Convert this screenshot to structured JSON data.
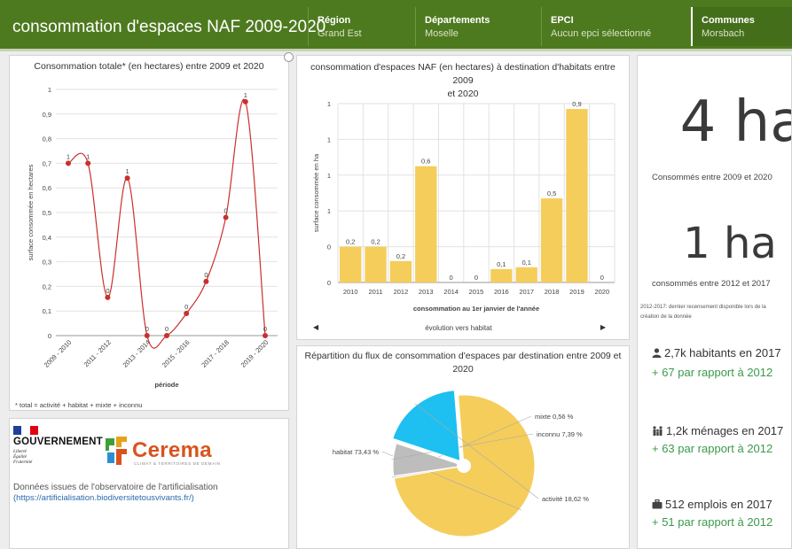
{
  "header": {
    "title": "consommation d'espaces NAF 2009-2020",
    "filters": [
      {
        "label": "Région",
        "value": "Grand Est"
      },
      {
        "label": "Départements",
        "value": "Moselle"
      },
      {
        "label": "EPCI",
        "value": "Aucun epci sélectionné"
      },
      {
        "label": "Communes",
        "value": "Morsbach"
      }
    ]
  },
  "line_panel": {
    "title": "Consommation totale* (en hectares) entre 2009 et 2020",
    "note": "* total = activité + habitat + mixte + inconnu"
  },
  "bar_panel": {
    "title_line1": "consommation d'espaces NAF (en hectares) à destination d'habitats entre 2009",
    "title_line2": "et 2020",
    "scroller_label": "évolution vers habitat",
    "prev_arrow": "◀",
    "next_arrow": "▶"
  },
  "pie_panel": {
    "title_line1": "Répartition du flux de consommation d'espaces par destination entre 2009 et",
    "title_line2": "2020"
  },
  "logos": {
    "gov_name": "GOUVERNEMENT",
    "devise": "Liberté\nÉgalité\nFraternité",
    "cerema_name": "Cerema",
    "cerema_tagline": "CLIMAT & TERRITOIRES DE DEMAIN",
    "source_text": "Données issues de l'observatoire de l'artificialisation",
    "source_link": "(https://artificialisation.biodiversitetousvivants.fr/)"
  },
  "stats": {
    "total_value": "4 ha",
    "total_caption": "Consommés entre 2009 et 2020",
    "recent_value": "1 ha",
    "recent_caption": "consommés entre 2012 et 2017",
    "recent_note_line1": "2012-2017: dernier recensement disponible lors de la",
    "recent_note_line2": "création de la donnée",
    "habitants": "2,7k habitants en 2017",
    "habitants_diff": "+ 67 par rapport à 2012",
    "menages": "1,2k ménages en 2017",
    "menages_diff": "+ 63 par rapport à 2012",
    "emplois": "512 emplois en 2017",
    "emplois_diff": "+ 51 par rapport à 2012"
  },
  "colors": {
    "header": "#4e7a1f",
    "bar": "#f5cd5b",
    "line": "#c9302c",
    "positive": "#3b9a4b",
    "cerema": "#d9531e"
  },
  "icons": {
    "habitants": "person-icon",
    "menages": "family-icon",
    "emplois": "briefcase-icon"
  },
  "chart_data": [
    {
      "type": "line",
      "title": "Consommation totale* (en hectares) entre 2009 et 2020",
      "xlabel": "période",
      "ylabel": "surface consommée en hectares",
      "ylim": [
        0,
        1
      ],
      "yticks": [
        "0",
        "0,1",
        "0,2",
        "0,3",
        "0,4",
        "0,5",
        "0,6",
        "0,7",
        "0,8",
        "0,9",
        "1"
      ],
      "categories": [
        "2009 - 2010",
        "2010 - 2011",
        "2011 - 2012",
        "2012 - 2013",
        "2013 - 2014",
        "2014 - 2015",
        "2015 - 2016",
        "2016 - 2017",
        "2017 - 2018",
        "2018 - 2019",
        "2019 - 2020"
      ],
      "tick_labels": [
        "2009 - 2010",
        "",
        "2011 - 2012",
        "",
        "2013 - 2014",
        "",
        "2015 - 2016",
        "",
        "2017 - 2018",
        "",
        "2019 - 2020"
      ],
      "values": [
        0.7,
        0.7,
        0.155,
        0.64,
        0,
        0,
        0.09,
        0.22,
        0.48,
        0.95,
        0
      ],
      "data_labels": [
        "1",
        "1",
        "0",
        "1",
        "0",
        "0",
        "0",
        "0",
        "0",
        "1",
        "0"
      ]
    },
    {
      "type": "bar",
      "title": "consommation d'espaces NAF (en hectares) à destination d'habitats entre 2009 et 2020",
      "xlabel": "consommation au 1er janvier de l'année",
      "ylabel": "surface consommée en ha",
      "ylim": [
        0,
        1
      ],
      "yticks": [
        "0",
        "0",
        "1",
        "1",
        "1",
        "1"
      ],
      "categories": [
        "2010",
        "2011",
        "2012",
        "2013",
        "2014",
        "2015",
        "2016",
        "2017",
        "2018",
        "2019",
        "2020"
      ],
      "values": [
        0.2,
        0.2,
        0.12,
        0.65,
        0,
        0,
        0.075,
        0.085,
        0.47,
        0.97,
        0
      ],
      "data_labels": [
        "0,2",
        "0,2",
        "0,2",
        "0,6",
        "0",
        "0",
        "0,1",
        "0,1",
        "0,5",
        "0,9",
        "0"
      ]
    },
    {
      "type": "pie",
      "title": "Répartition du flux de consommation d'espaces par destination entre 2009 et 2020",
      "slices": [
        {
          "label": "habitat 73,43 %",
          "value": 73.43,
          "color": "#f5cd5b"
        },
        {
          "label": "mixte 0,56 %",
          "value": 0.56,
          "color": "#e8e8e8"
        },
        {
          "label": "inconnu 7,39 %",
          "value": 7.39,
          "color": "#bdbdbd"
        },
        {
          "label": "activité 18,62 %",
          "value": 18.62,
          "color": "#1dc0f0"
        }
      ]
    }
  ]
}
